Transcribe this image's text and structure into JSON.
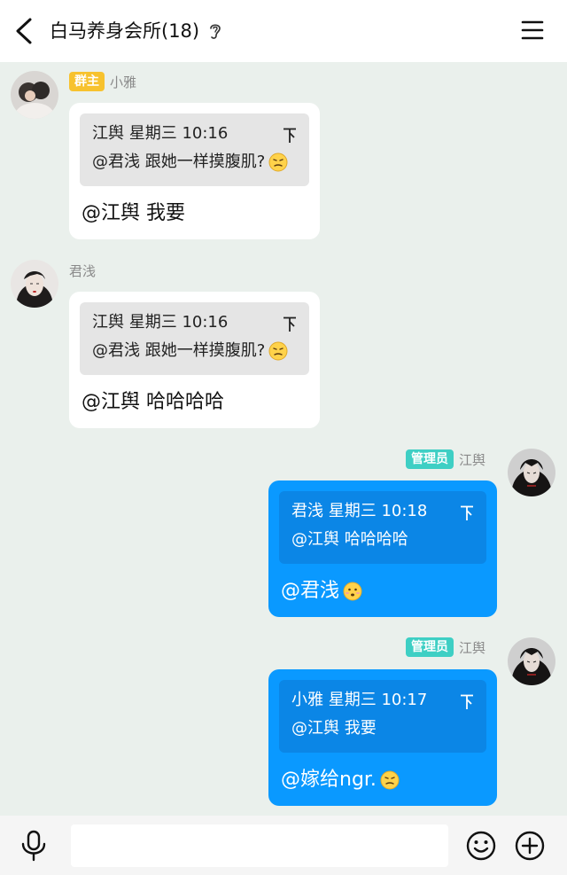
{
  "header": {
    "title": "白马养身会所(18)"
  },
  "messages": [
    {
      "sender": "小雅",
      "role_badge": "群主",
      "direction": "in",
      "quote": {
        "author_time": "江舆 星期三 10:16",
        "text": "@君浅 跟她一样摸腹肌?"
      },
      "reply": "@江舆 我要"
    },
    {
      "sender": "君浅",
      "role_badge": "",
      "direction": "in",
      "quote": {
        "author_time": "江舆 星期三 10:16",
        "text": "@君浅 跟她一样摸腹肌?"
      },
      "reply": "@江舆 哈哈哈哈"
    },
    {
      "sender": "江舆",
      "role_badge": "管理员",
      "direction": "out",
      "quote": {
        "author_time": "君浅 星期三 10:18",
        "text": "@江舆 哈哈哈哈"
      },
      "reply": "@君浅"
    },
    {
      "sender": "江舆",
      "role_badge": "管理员",
      "direction": "out",
      "quote": {
        "author_time": "小雅 星期三 10:17",
        "text": "@江舆 我要"
      },
      "reply": "@嫁给ngr."
    }
  ],
  "icons": {
    "back": "chevron-left-icon",
    "ear": "ear-icon",
    "menu": "hamburger-menu-icon",
    "jump": "jump-to-top-icon",
    "mic": "microphone-icon",
    "emoji": "smiley-face-icon",
    "plus": "plus-circle-icon"
  },
  "colors": {
    "background": "#eaf0ec",
    "outgoing_bubble": "#0a99ff",
    "outgoing_quote": "#0b86e6",
    "incoming_bubble": "#ffffff",
    "incoming_quote": "#e5e5e5",
    "owner_badge": "#f7c22e",
    "admin_badge": "#3ecfc4"
  }
}
